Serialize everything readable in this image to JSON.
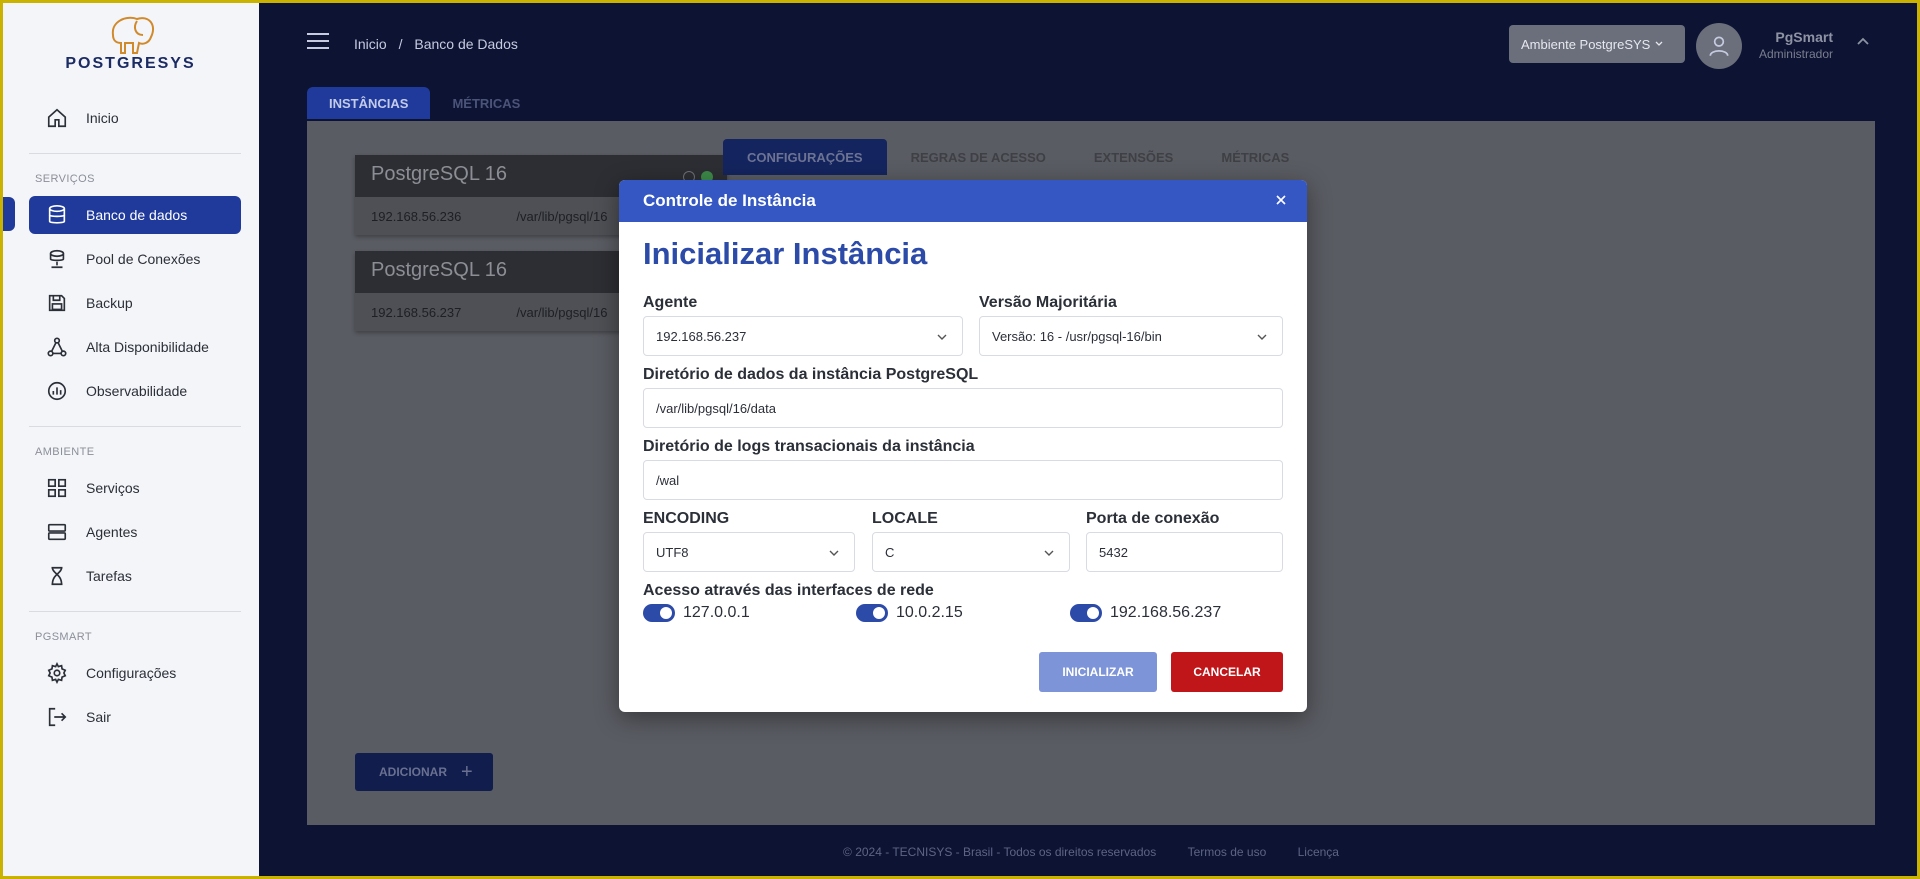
{
  "brand": {
    "name": "POSTGRESYS"
  },
  "sidebar": {
    "home_label": "Inicio",
    "sections": [
      {
        "title": "SERVIÇOS",
        "items": [
          {
            "label": "Banco de dados",
            "icon": "database-icon",
            "active": true
          },
          {
            "label": "Pool de Conexões",
            "icon": "pool-icon"
          },
          {
            "label": "Backup",
            "icon": "backup-icon"
          },
          {
            "label": "Alta Disponibilidade",
            "icon": "cluster-icon"
          },
          {
            "label": "Observabilidade",
            "icon": "chart-icon"
          }
        ]
      },
      {
        "title": "AMBIENTE",
        "items": [
          {
            "label": "Serviços",
            "icon": "grid-icon"
          },
          {
            "label": "Agentes",
            "icon": "server-icon"
          },
          {
            "label": "Tarefas",
            "icon": "hourglass-icon"
          }
        ]
      },
      {
        "title": "PGSMART",
        "items": [
          {
            "label": "Configurações",
            "icon": "gear-icon"
          },
          {
            "label": "Sair",
            "icon": "logout-icon"
          }
        ]
      }
    ]
  },
  "header": {
    "breadcrumb": [
      "Inicio",
      "/",
      "Banco de Dados"
    ],
    "environment": "Ambiente PostgreSYS",
    "user_name": "PgSmart",
    "user_role": "Administrador"
  },
  "top_tabs": [
    "INSTÂNCIAS",
    "MÉTRICAS"
  ],
  "instances": [
    {
      "title": "PostgreSQL 16",
      "ip": "192.168.56.236",
      "path": "/var/lib/pgsql/16"
    },
    {
      "title": "PostgreSQL 16",
      "ip": "192.168.56.237",
      "path": "/var/lib/pgsql/16"
    }
  ],
  "inner_tabs": [
    "CONFIGURAÇÕES",
    "REGRAS DE ACESSO",
    "EXTENSÕES",
    "MÉTRICAS"
  ],
  "add_button": "ADICIONAR",
  "footer": {
    "copyright": "© 2024 - TECNISYS - Brasil - Todos os direitos reservados",
    "terms": "Termos de uso",
    "license": "Licença"
  },
  "modal": {
    "header": "Controle de Instância",
    "title": "Inicializar Instância",
    "agent_label": "Agente",
    "agent_value": "192.168.56.237",
    "version_label": "Versão Majoritária",
    "version_value": "Versão: 16 - /usr/pgsql-16/bin",
    "data_dir_label": "Diretório de dados da instância PostgreSQL",
    "data_dir_value": "/var/lib/pgsql/16/data",
    "wal_dir_label": "Diretório de logs transacionais da instância",
    "wal_dir_value": "/wal",
    "encoding_label": "ENCODING",
    "encoding_value": "UTF8",
    "locale_label": "LOCALE",
    "locale_value": "C",
    "port_label": "Porta de conexão",
    "port_value": "5432",
    "interfaces_label": "Acesso através das interfaces de rede",
    "interfaces": [
      {
        "label": "127.0.0.1",
        "enabled": true
      },
      {
        "label": "10.0.2.15",
        "enabled": true
      },
      {
        "label": "192.168.56.237",
        "enabled": true
      }
    ],
    "init_button": "INICIALIZAR",
    "cancel_button": "CANCELAR"
  },
  "colors": {
    "primary": "#3557c4",
    "danger": "#c0161a",
    "sidebar_bg": "#f4f5f8",
    "main_bg": "#0d1333"
  }
}
